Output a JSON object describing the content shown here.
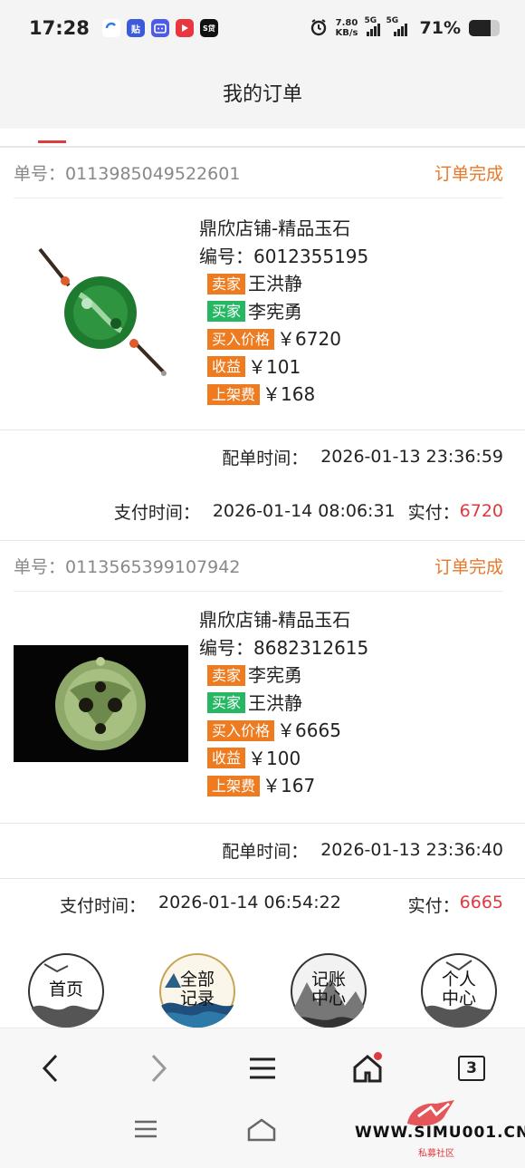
{
  "status_bar": {
    "time": "17:28",
    "app_icons": [
      "sync-icon",
      "tieba-icon",
      "bilibili-icon",
      "video-icon",
      "s-app-icon"
    ],
    "net_speed_value": "7.80",
    "net_speed_unit": "KB/s",
    "signal1_label": "5G",
    "signal2_label": "5G",
    "battery_percent": "71%",
    "battery_level": 0.71
  },
  "header": {
    "title": "我的订单"
  },
  "orders": [
    {
      "order_no": "单号：0113985049522601",
      "status": "订单完成",
      "shop": "鼎欣店铺-精品玉石",
      "code": "编号：6012355195",
      "seller_tag": "卖家",
      "seller": "王洪静",
      "buyer_tag": "买家",
      "buyer": "李宪勇",
      "price_tag": "买入价格",
      "price": "￥6720",
      "profit_tag": "收益",
      "profit": "￥101",
      "fee_tag": "上架费",
      "fee": "￥168",
      "match_label": "配单时间：",
      "match_time": "2026-01-13 23:36:59",
      "pay_label": "支付时间：",
      "pay_time": "2026-01-14 08:06:31",
      "paid_label": "实付：",
      "paid_amount": "6720"
    },
    {
      "order_no": "单号：0113565399107942",
      "status": "订单完成",
      "shop": "鼎欣店铺-精品玉石",
      "code": "编号：8682312615",
      "seller_tag": "卖家",
      "seller": "李宪勇",
      "buyer_tag": "买家",
      "buyer": "王洪静",
      "price_tag": "买入价格",
      "price": "￥6665",
      "profit_tag": "收益",
      "profit": "￥100",
      "fee_tag": "上架费",
      "fee": "￥167",
      "match_label": "配单时间：",
      "match_time": "2026-01-13 23:36:40",
      "pay_label": "支付时间：",
      "pay_time": "2026-01-14 06:54:22",
      "paid_label": "实付：",
      "paid_amount": "6665"
    }
  ],
  "bottom_nav": {
    "home": "首页",
    "all_records": "全部记录",
    "accounting": "记账中心",
    "personal": "个人中心"
  },
  "browser": {
    "tab_count": "3"
  },
  "watermark": {
    "site": "WWW.SIMU001.CN",
    "sub": "私募社区"
  },
  "colors": {
    "accent_red": "#e0393e",
    "status_orange": "#e8782a",
    "tag_orange": "#ee7b20",
    "tag_green": "#27b764"
  }
}
